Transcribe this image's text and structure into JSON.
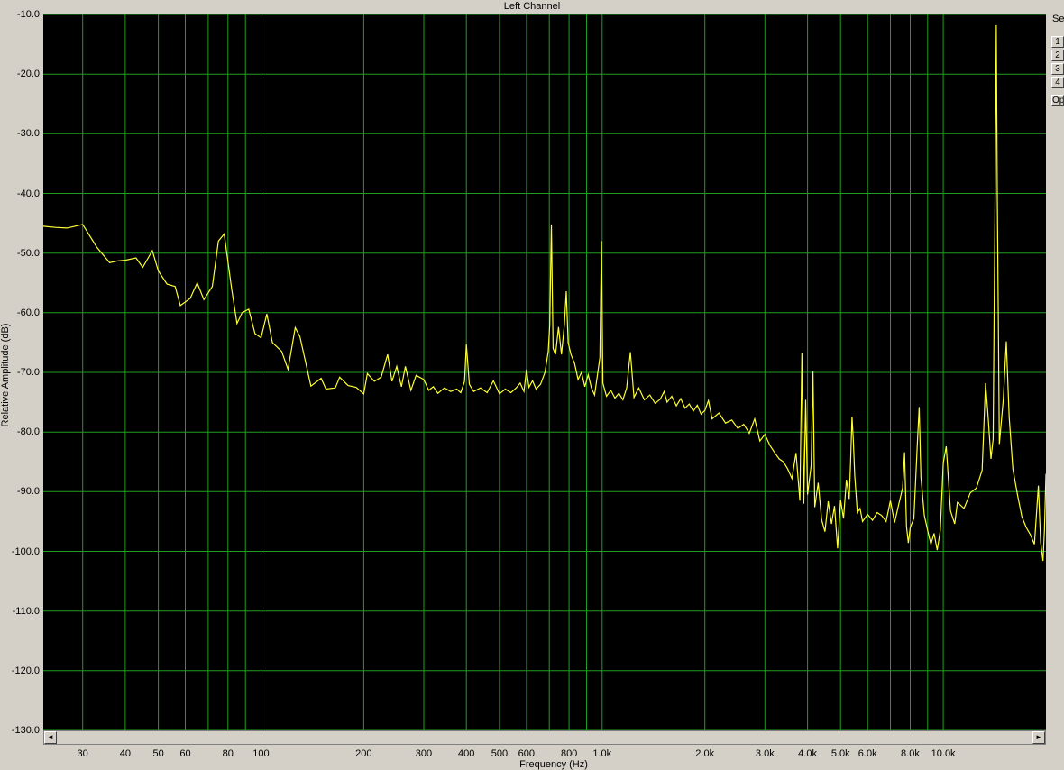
{
  "window": {
    "title": "Left Channel"
  },
  "side_panel": {
    "label": "Set",
    "buttons": [
      "1",
      "2",
      "3",
      "4",
      "Op"
    ]
  },
  "scrollbar": {
    "left_arrow": "◄",
    "right_arrow": "►"
  },
  "colors": {
    "background": "#000000",
    "grid": "#1f9e1f",
    "trace": "#ffff33",
    "chrome": "#d4d0c8"
  },
  "chart_data": {
    "type": "line",
    "title": "Left Channel",
    "xlabel": "Frequency (Hz)",
    "ylabel": "Relative Amplitude (dB)",
    "xscale": "log",
    "xlim": [
      23,
      20000
    ],
    "ylim": [
      -130,
      -10
    ],
    "grid": true,
    "x_tick_labels": [
      {
        "x": 30,
        "label": "30"
      },
      {
        "x": 40,
        "label": "40"
      },
      {
        "x": 50,
        "label": "50"
      },
      {
        "x": 60,
        "label": "60"
      },
      {
        "x": 80,
        "label": "80"
      },
      {
        "x": 100,
        "label": "100"
      },
      {
        "x": 200,
        "label": "200"
      },
      {
        "x": 300,
        "label": "300"
      },
      {
        "x": 400,
        "label": "400"
      },
      {
        "x": 500,
        "label": "500"
      },
      {
        "x": 600,
        "label": "600"
      },
      {
        "x": 800,
        "label": "800"
      },
      {
        "x": 1000,
        "label": "1.0k"
      },
      {
        "x": 2000,
        "label": "2.0k"
      },
      {
        "x": 3000,
        "label": "3.0k"
      },
      {
        "x": 4000,
        "label": "4.0k"
      },
      {
        "x": 5000,
        "label": "5.0k"
      },
      {
        "x": 6000,
        "label": "6.0k"
      },
      {
        "x": 8000,
        "label": "8.0k"
      },
      {
        "x": 10000,
        "label": "10.0k"
      }
    ],
    "x_minor_gridlines": [
      70,
      90,
      700,
      900,
      7000,
      9000
    ],
    "y_tick_labels": [
      {
        "y": -10,
        "label": "-10.0"
      },
      {
        "y": -20,
        "label": "-20.0"
      },
      {
        "y": -30,
        "label": "-30.0"
      },
      {
        "y": -40,
        "label": "-40.0"
      },
      {
        "y": -50,
        "label": "-50.0"
      },
      {
        "y": -60,
        "label": "-60.0"
      },
      {
        "y": -70,
        "label": "-70.0"
      },
      {
        "y": -80,
        "label": "-80.0"
      },
      {
        "y": -90,
        "label": "-90.0"
      },
      {
        "y": -100,
        "label": "-100.0"
      },
      {
        "y": -110,
        "label": "-110.0"
      },
      {
        "y": -120,
        "label": "-120.0"
      },
      {
        "y": -130,
        "label": "-130.0"
      }
    ],
    "series": [
      {
        "points": [
          [
            23,
            -45.5
          ],
          [
            25,
            -45.7
          ],
          [
            27,
            -45.8
          ],
          [
            30,
            -45.2
          ],
          [
            33,
            -49
          ],
          [
            36,
            -51.6
          ],
          [
            38,
            -51.3
          ],
          [
            40,
            -51.2
          ],
          [
            43,
            -50.8
          ],
          [
            45,
            -52.4
          ],
          [
            48,
            -49.6
          ],
          [
            50,
            -53
          ],
          [
            53,
            -55.2
          ],
          [
            56,
            -55.6
          ],
          [
            58,
            -58.8
          ],
          [
            62,
            -57.6
          ],
          [
            65,
            -55
          ],
          [
            68,
            -57.8
          ],
          [
            72,
            -55.6
          ],
          [
            75,
            -48
          ],
          [
            78,
            -46.8
          ],
          [
            82,
            -56
          ],
          [
            85,
            -61.8
          ],
          [
            88,
            -60
          ],
          [
            92,
            -59.4
          ],
          [
            96,
            -63.5
          ],
          [
            100,
            -64.2
          ],
          [
            104,
            -60.2
          ],
          [
            108,
            -65
          ],
          [
            115,
            -66.5
          ],
          [
            120,
            -69.5
          ],
          [
            126,
            -62.5
          ],
          [
            130,
            -64
          ],
          [
            140,
            -72.3
          ],
          [
            150,
            -71
          ],
          [
            155,
            -72.8
          ],
          [
            165,
            -72.6
          ],
          [
            170,
            -70.8
          ],
          [
            180,
            -72.2
          ],
          [
            190,
            -72.5
          ],
          [
            200,
            -73.6
          ],
          [
            205,
            -70.2
          ],
          [
            215,
            -71.5
          ],
          [
            225,
            -70.8
          ],
          [
            235,
            -67
          ],
          [
            242,
            -71.5
          ],
          [
            250,
            -69
          ],
          [
            258,
            -72.4
          ],
          [
            265,
            -69
          ],
          [
            275,
            -73
          ],
          [
            285,
            -70.5
          ],
          [
            300,
            -71.2
          ],
          [
            310,
            -73
          ],
          [
            320,
            -72.4
          ],
          [
            330,
            -73.5
          ],
          [
            345,
            -72.6
          ],
          [
            360,
            -73.2
          ],
          [
            375,
            -72.8
          ],
          [
            385,
            -73.4
          ],
          [
            395,
            -71.5
          ],
          [
            400,
            -65.3
          ],
          [
            408,
            -72
          ],
          [
            420,
            -73.2
          ],
          [
            440,
            -72.6
          ],
          [
            460,
            -73.4
          ],
          [
            480,
            -71.4
          ],
          [
            500,
            -73.6
          ],
          [
            520,
            -72.8
          ],
          [
            540,
            -73.4
          ],
          [
            560,
            -72.6
          ],
          [
            575,
            -71.8
          ],
          [
            590,
            -73.2
          ],
          [
            600,
            -69.5
          ],
          [
            610,
            -72.5
          ],
          [
            625,
            -71.4
          ],
          [
            640,
            -72.8
          ],
          [
            660,
            -72
          ],
          [
            680,
            -70
          ],
          [
            695,
            -66.5
          ],
          [
            702,
            -62
          ],
          [
            710,
            -45.2
          ],
          [
            718,
            -66
          ],
          [
            730,
            -67
          ],
          [
            745,
            -62.4
          ],
          [
            760,
            -67
          ],
          [
            775,
            -62
          ],
          [
            785,
            -56.4
          ],
          [
            795,
            -65
          ],
          [
            810,
            -67
          ],
          [
            830,
            -68.5
          ],
          [
            850,
            -71.2
          ],
          [
            870,
            -70
          ],
          [
            890,
            -72.4
          ],
          [
            910,
            -70.4
          ],
          [
            930,
            -72.6
          ],
          [
            950,
            -73.8
          ],
          [
            970,
            -70.2
          ],
          [
            985,
            -67.5
          ],
          [
            995,
            -48
          ],
          [
            1005,
            -71.8
          ],
          [
            1030,
            -74
          ],
          [
            1060,
            -73
          ],
          [
            1090,
            -74.3
          ],
          [
            1120,
            -73.5
          ],
          [
            1150,
            -74.6
          ],
          [
            1180,
            -72.6
          ],
          [
            1210,
            -66.6
          ],
          [
            1240,
            -74.2
          ],
          [
            1280,
            -72.6
          ],
          [
            1330,
            -74.6
          ],
          [
            1380,
            -73.8
          ],
          [
            1430,
            -75.2
          ],
          [
            1480,
            -74.5
          ],
          [
            1520,
            -73.2
          ],
          [
            1550,
            -75
          ],
          [
            1600,
            -74
          ],
          [
            1650,
            -75.6
          ],
          [
            1700,
            -74.4
          ],
          [
            1750,
            -76
          ],
          [
            1800,
            -75.3
          ],
          [
            1850,
            -76.5
          ],
          [
            1900,
            -75.5
          ],
          [
            1950,
            -77
          ],
          [
            2000,
            -76.4
          ],
          [
            2050,
            -74.7
          ],
          [
            2100,
            -77.8
          ],
          [
            2200,
            -76.8
          ],
          [
            2300,
            -78.5
          ],
          [
            2400,
            -78
          ],
          [
            2500,
            -79.4
          ],
          [
            2600,
            -78.7
          ],
          [
            2700,
            -80.2
          ],
          [
            2800,
            -77.8
          ],
          [
            2900,
            -81.5
          ],
          [
            3000,
            -80.4
          ],
          [
            3100,
            -82.2
          ],
          [
            3200,
            -83.4
          ],
          [
            3300,
            -84.5
          ],
          [
            3400,
            -85
          ],
          [
            3500,
            -86.2
          ],
          [
            3600,
            -87.8
          ],
          [
            3700,
            -83.5
          ],
          [
            3800,
            -91.5
          ],
          [
            3850,
            -66.8
          ],
          [
            3900,
            -92
          ],
          [
            3950,
            -74.6
          ],
          [
            4000,
            -90.5
          ],
          [
            4100,
            -85.6
          ],
          [
            4150,
            -69.8
          ],
          [
            4200,
            -92.6
          ],
          [
            4300,
            -88.5
          ],
          [
            4400,
            -94.7
          ],
          [
            4500,
            -96.7
          ],
          [
            4600,
            -91.6
          ],
          [
            4700,
            -95.4
          ],
          [
            4800,
            -92.4
          ],
          [
            4900,
            -99.5
          ],
          [
            5000,
            -91.4
          ],
          [
            5100,
            -94.5
          ],
          [
            5200,
            -88
          ],
          [
            5300,
            -91.2
          ],
          [
            5350,
            -85.2
          ],
          [
            5400,
            -77.4
          ],
          [
            5450,
            -81.5
          ],
          [
            5500,
            -87.2
          ],
          [
            5600,
            -93.5
          ],
          [
            5700,
            -92.8
          ],
          [
            5800,
            -95
          ],
          [
            6000,
            -93.8
          ],
          [
            6200,
            -94.8
          ],
          [
            6400,
            -93.5
          ],
          [
            6600,
            -94
          ],
          [
            6800,
            -95
          ],
          [
            7000,
            -91.5
          ],
          [
            7200,
            -95.2
          ],
          [
            7400,
            -92.2
          ],
          [
            7600,
            -89.4
          ],
          [
            7700,
            -83.4
          ],
          [
            7800,
            -95.8
          ],
          [
            7900,
            -98.6
          ],
          [
            8000,
            -96
          ],
          [
            8200,
            -94.5
          ],
          [
            8400,
            -81.5
          ],
          [
            8500,
            -75.8
          ],
          [
            8600,
            -87.5
          ],
          [
            8800,
            -94
          ],
          [
            9000,
            -96.5
          ],
          [
            9200,
            -98.8
          ],
          [
            9400,
            -97
          ],
          [
            9600,
            -99.8
          ],
          [
            9800,
            -96.5
          ],
          [
            10000,
            -85.2
          ],
          [
            10200,
            -82.4
          ],
          [
            10500,
            -93.2
          ],
          [
            10800,
            -95.4
          ],
          [
            11000,
            -91.8
          ],
          [
            11500,
            -92.8
          ],
          [
            12000,
            -90.2
          ],
          [
            12500,
            -89.4
          ],
          [
            13000,
            -86.4
          ],
          [
            13300,
            -71.8
          ],
          [
            13500,
            -76.5
          ],
          [
            13800,
            -84.5
          ],
          [
            14000,
            -81.2
          ],
          [
            14200,
            -38.2
          ],
          [
            14300,
            -11.8
          ],
          [
            14400,
            -40
          ],
          [
            14600,
            -82
          ],
          [
            15000,
            -74.5
          ],
          [
            15300,
            -64.8
          ],
          [
            15600,
            -77.5
          ],
          [
            16000,
            -86.2
          ],
          [
            16500,
            -90.5
          ],
          [
            17000,
            -94.2
          ],
          [
            17500,
            -96
          ],
          [
            18000,
            -97.2
          ],
          [
            18500,
            -98.8
          ],
          [
            19000,
            -89
          ],
          [
            19300,
            -98.5
          ],
          [
            19600,
            -101.6
          ],
          [
            19800,
            -96.5
          ],
          [
            20000,
            -87
          ]
        ]
      }
    ]
  }
}
